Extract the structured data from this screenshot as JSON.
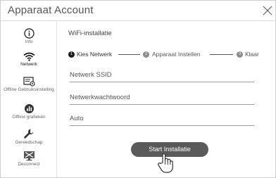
{
  "window": {
    "title": "Apparaat Account"
  },
  "sidebar": {
    "items": [
      {
        "label": "Info",
        "icon": "info-icon"
      },
      {
        "label": "Netwerk",
        "icon": "wifi-icon",
        "active": true
      },
      {
        "label": "Offline Gebruiksinstelling",
        "icon": "offline-settings-icon"
      },
      {
        "label": "Offline grafieken",
        "icon": "pie-chart-icon"
      },
      {
        "label": "Gereedschap",
        "icon": "wrench-icon"
      },
      {
        "label": "Deconnect",
        "icon": "disconnect-icon"
      }
    ]
  },
  "main": {
    "title": "WiFi-installatie",
    "steps": [
      {
        "number": "1",
        "label": "Kies Netwerk",
        "active": true
      },
      {
        "number": "2",
        "label": "Apparaat Instellen",
        "active": false
      },
      {
        "number": "3",
        "label": "Klaar",
        "active": false
      }
    ],
    "fields": {
      "ssid": "Netwerk SSID",
      "password": "Netwerkwachtwoord",
      "security": "Auto"
    },
    "start_button": "Start Installatie"
  },
  "colors": {
    "active_step": "#1a1a1a",
    "inactive_step": "#8a8a8a",
    "button": "#5a5a5a"
  }
}
